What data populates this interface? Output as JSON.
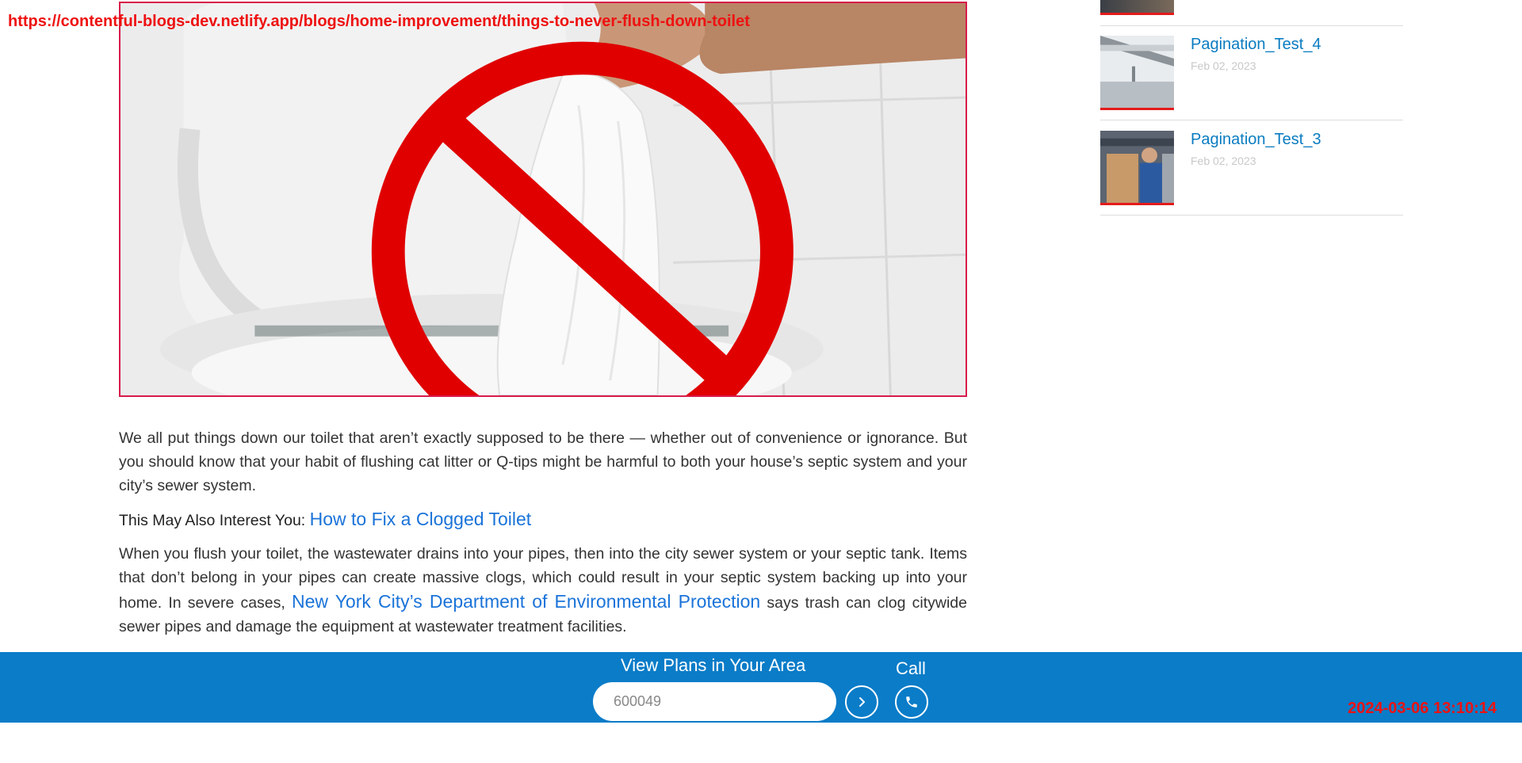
{
  "overlay": {
    "url": "https://contentful-blogs-dev.netlify.app/blogs/home-improvement/things-to-never-flush-down-toilet",
    "timestamp": "2024-03-06 13:10:14"
  },
  "hero": {
    "icon": "no-flush-sign",
    "prohibition_color": "#e00000"
  },
  "article": {
    "paragraph_1": "We all put things down our toilet that aren’t exactly supposed to be there — whether out of convenience or ignorance. But you should know that your habit of flushing cat litter or Q-tips might be harmful to both your house’s septic system and your city’s sewer system.",
    "interest_label": "This May Also Interest You:",
    "interest_link": "How to Fix a Clogged Toilet",
    "paragraph_2_before": "When you flush your toilet, the wastewater drains into your pipes, then into the city sewer system or your septic tank. Items that don’t belong in your pipes can create massive clogs, which could result in your septic system backing up into your home. In severe cases,",
    "paragraph_2_link": "New York City’s Department of Environmental Protection",
    "paragraph_2_after": "says trash can clog citywide sewer pipes and damage the equipment at wastewater treatment facilities."
  },
  "sidebar": {
    "items": [
      {
        "title": "Pagination_Test_4",
        "date": "Feb 02, 2023"
      },
      {
        "title": "Pagination_Test_3",
        "date": "Feb 02, 2023"
      }
    ]
  },
  "plans_bar": {
    "label": "View Plans in Your Area",
    "zip_value": "600049",
    "call_label": "Call",
    "accent": "#0a7cc8"
  }
}
